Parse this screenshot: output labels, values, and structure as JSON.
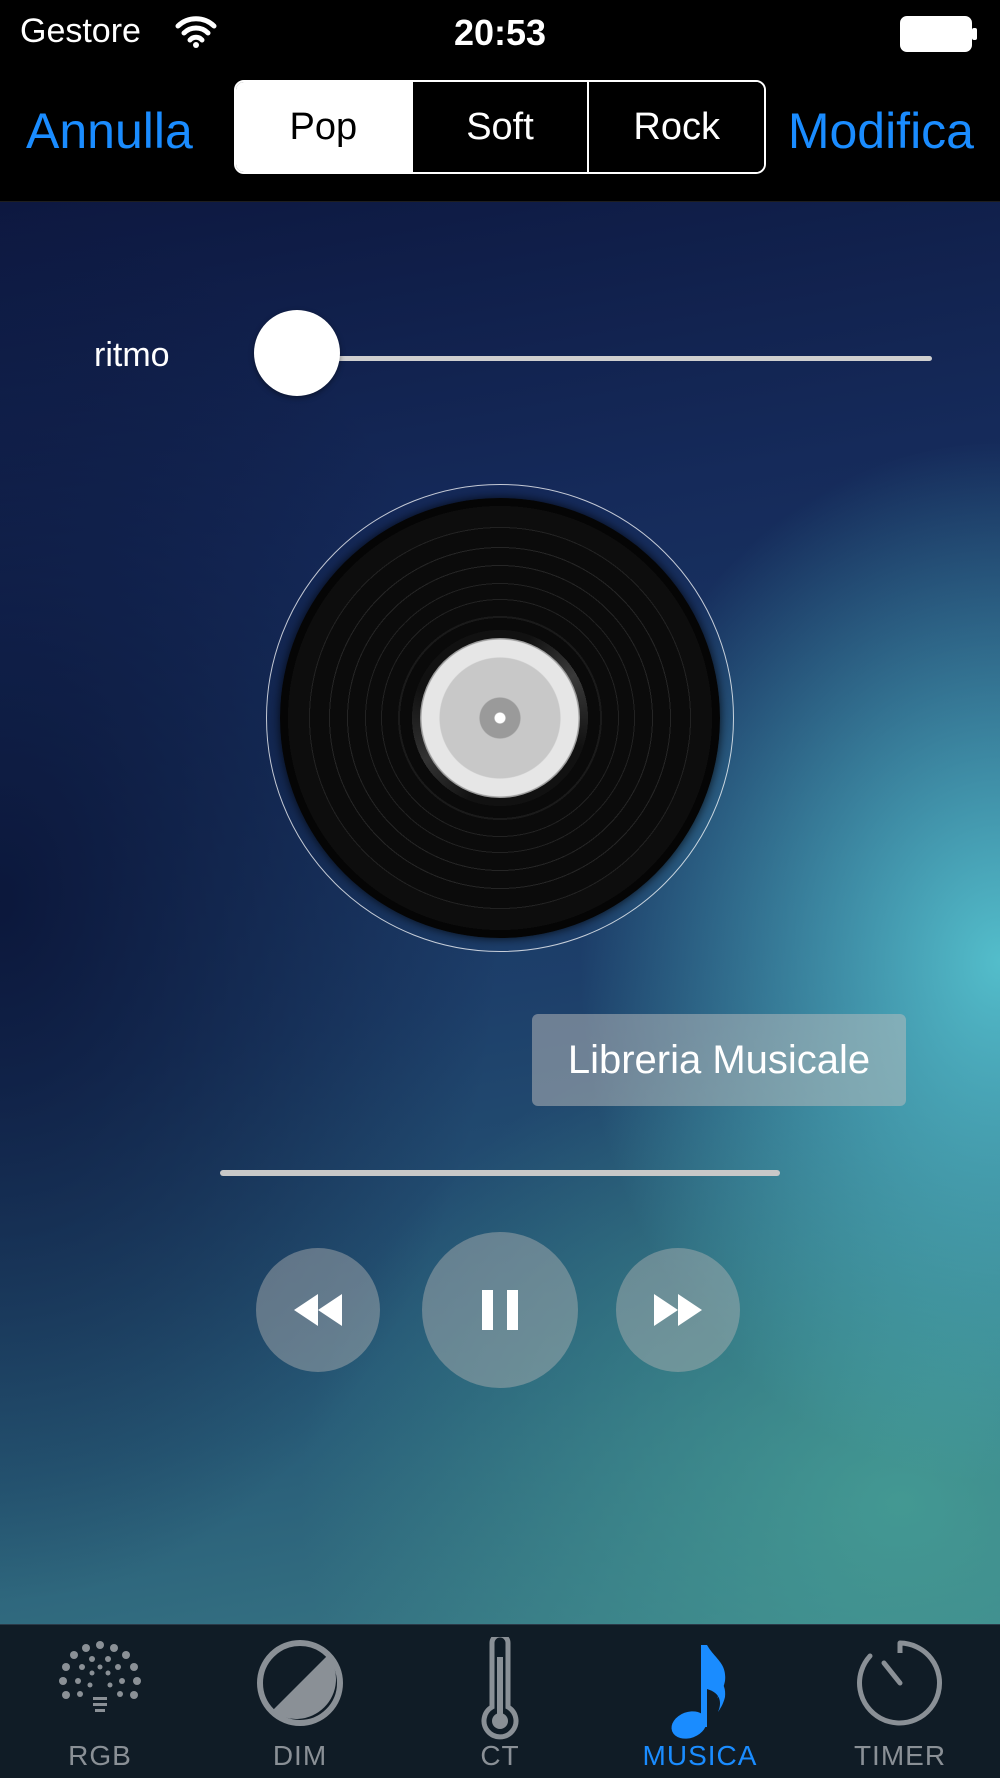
{
  "status_bar": {
    "carrier": "Gestore",
    "time": "20:53"
  },
  "nav": {
    "cancel_label": "Annulla",
    "edit_label": "Modifica",
    "segments": [
      "Pop",
      "Soft",
      "Rock"
    ],
    "selected_segment": "Pop"
  },
  "rhythm": {
    "label": "ritmo",
    "value": 0.0
  },
  "library_button_label": "Libreria Musicale",
  "playback": {
    "progress": 0.0,
    "state": "playing"
  },
  "tabs": [
    {
      "label": "RGB",
      "icon": "rgb-dots-icon",
      "active": false
    },
    {
      "label": "DIM",
      "icon": "dim-circle-icon",
      "active": false
    },
    {
      "label": "CT",
      "icon": "thermometer-icon",
      "active": false
    },
    {
      "label": "MUSICA",
      "icon": "music-note-icon",
      "active": true
    },
    {
      "label": "TIMER",
      "icon": "timer-icon",
      "active": false
    }
  ],
  "colors": {
    "accent": "#1a8cff",
    "tab_inactive": "#8a9096",
    "tab_bar_bg": "#101c26"
  }
}
